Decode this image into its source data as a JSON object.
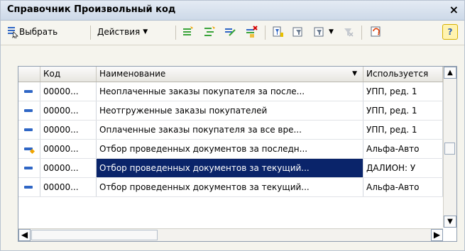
{
  "window": {
    "title": "Справочник Произвольный код",
    "close_label": "×"
  },
  "toolbar": {
    "select_label": "Выбрать",
    "actions_label": "Действия",
    "help_label": "?"
  },
  "table": {
    "columns": [
      "Код",
      "Наименование",
      "Используется"
    ],
    "sort_indicator": "▼",
    "rows": [
      {
        "code": "00000...",
        "name": "Неоплаченные заказы покупателя за после...",
        "used": "УПП, ред. 1"
      },
      {
        "code": "00000...",
        "name": "Неотгруженные заказы покупателей",
        "used": "УПП, ред. 1"
      },
      {
        "code": "00000...",
        "name": "Оплаченные заказы покупателя за все вре...",
        "used": "УПП, ред. 1"
      },
      {
        "code": "00000...",
        "name": "Отбор проведенных документов за последн...",
        "used": "Альфа-Авто"
      },
      {
        "code": "00000...",
        "name": "Отбор проведенных документов за текущий...",
        "used": "ДАЛИОН: У"
      },
      {
        "code": "00000...",
        "name": "Отбор проведенных документов за текущий...",
        "used": "Альфа-Авто"
      }
    ]
  }
}
